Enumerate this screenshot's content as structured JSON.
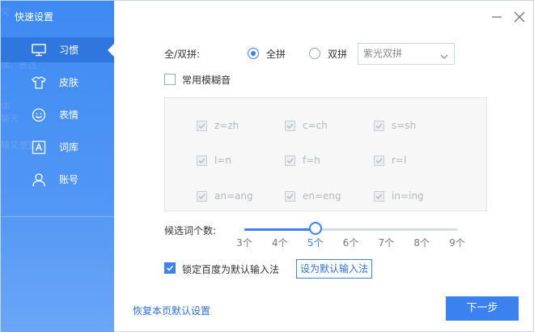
{
  "sidebar": {
    "title": "快速设置",
    "background_text": [
      "文",
      "",
      "",
      "DIY、表",
      "体、表达",
      "",
      "",
      "体",
      "聊天",
      "",
      "精又便宜",
      "",
      "",
      ""
    ],
    "items": [
      {
        "label": "习惯",
        "icon": "monitor-icon",
        "active": true
      },
      {
        "label": "皮肤",
        "icon": "tshirt-icon",
        "active": false
      },
      {
        "label": "表情",
        "icon": "smiley-icon",
        "active": false
      },
      {
        "label": "词库",
        "icon": "dictionary-icon",
        "active": false
      },
      {
        "label": "账号",
        "icon": "user-icon",
        "active": false
      }
    ]
  },
  "window_controls": {
    "minimize_icon": "minimize-icon",
    "close_icon": "close-icon"
  },
  "pinyin": {
    "label": "全/双拼:",
    "full_label": "全拼",
    "double_label": "双拼",
    "selected": "全拼",
    "scheme_select_value": "紫光双拼"
  },
  "fuzzy": {
    "label": "常用模糊音",
    "checked": false,
    "options": [
      [
        "z=zh",
        "c=ch",
        "s=sh"
      ],
      [
        "l=n",
        "f=h",
        "r=l"
      ],
      [
        "an=ang",
        "en=eng",
        "in=ing"
      ]
    ]
  },
  "candidates": {
    "label": "候选词个数:",
    "ticks": [
      "3个",
      "4个",
      "5个",
      "6个",
      "7个",
      "8个",
      "9个"
    ],
    "selected": "5个"
  },
  "default_ime": {
    "lock_label": "锁定百度为默认输入法",
    "lock_checked": true,
    "set_default_button": "设为默认输入法"
  },
  "footer": {
    "restore_link": "恢复本页默认设置",
    "next_button": "下一步"
  },
  "colors": {
    "accent": "#3b82f0",
    "sidebar": "#4f95f5",
    "sidebar_active": "#2f76de"
  }
}
